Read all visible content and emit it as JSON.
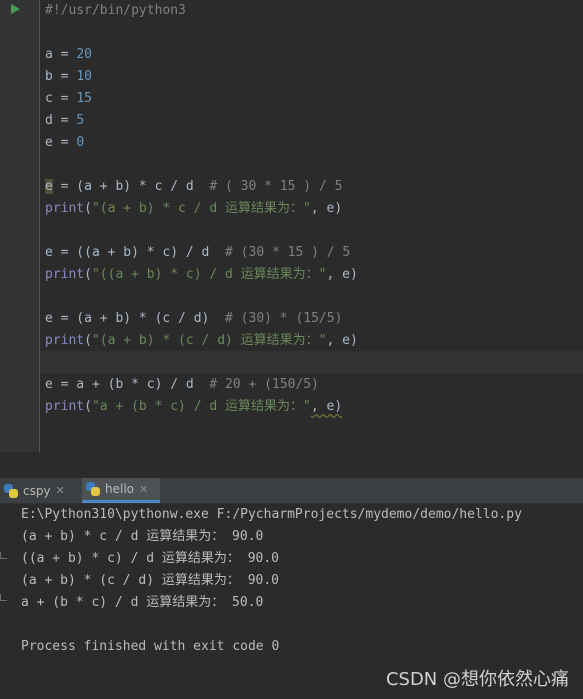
{
  "editor": {
    "shebang": "#!/usr/bin/python3",
    "assignments": [
      {
        "name": "a",
        "value": "20"
      },
      {
        "name": "b",
        "value": "10"
      },
      {
        "name": "c",
        "value": "15"
      },
      {
        "name": "d",
        "value": "5"
      },
      {
        "name": "e",
        "value": "0"
      }
    ],
    "blocks": [
      {
        "expr_prefix": "e",
        "expr": " = (a + b) * c / d  ",
        "comment": "# ( 30 * 15 ) / 5",
        "print_fn": "print",
        "print_str": "\"(a + b) * c / d 运算结果为：\"",
        "print_tail": ", e)"
      },
      {
        "expr_prefix": "e",
        "expr": " = ((a + b) * c) / d  ",
        "comment": "# (30 * 15 ) / 5",
        "print_fn": "print",
        "print_str": "\"((a + b) * c) / d 运算结果为：\"",
        "print_tail": ", e)"
      },
      {
        "expr_prefix": "e",
        "expr": " = (a + b) * (c / d)  ",
        "comment": "# (30) * (15/5)",
        "print_fn": "print",
        "print_str": "\"(a + b) * (c / d) 运算结果为：\"",
        "print_tail": ", e)"
      },
      {
        "expr_prefix": "e",
        "expr": " = a + (b * c) / d  ",
        "comment": "# 20 + (150/5)",
        "print_fn": "print",
        "print_str": "\"a + (b * c) / d 运算结果为：\"",
        "print_tail": ", e)"
      }
    ]
  },
  "run_panel": {
    "tabs": [
      {
        "label": "cspy",
        "active": false
      },
      {
        "label": "hello",
        "active": true
      }
    ],
    "output": [
      "E:\\Python310\\pythonw.exe F:/PycharmProjects/mydemo/demo/hello.py",
      "(a + b) * c / d 运算结果为： 90.0",
      "((a + b) * c) / d 运算结果为： 90.0",
      "(a + b) * (c / d) 运算结果为： 90.0",
      "a + (b * c) / d 运算结果为： 50.0",
      "",
      "Process finished with exit code 0"
    ]
  },
  "watermark": "CSDN @想你依然心痛"
}
